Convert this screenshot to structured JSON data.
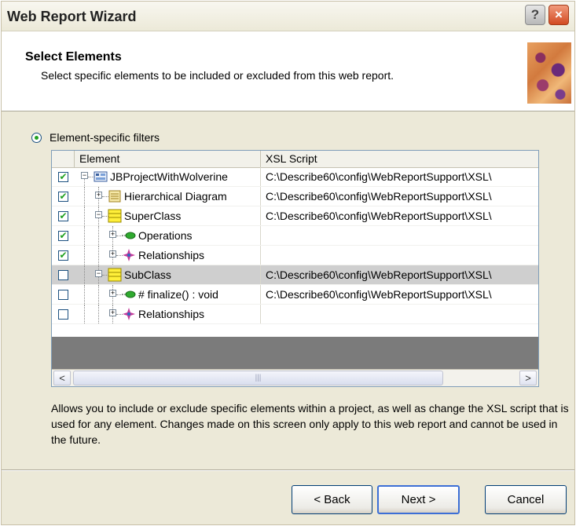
{
  "window": {
    "title": "Web Report Wizard"
  },
  "titlebar": {
    "help_glyph": "?",
    "close_glyph": "×"
  },
  "header": {
    "title": "Select Elements",
    "subtitle": "Select specific elements to be included or excluded from this web report.",
    "art_icon": "wizard-header-art-icon"
  },
  "filter": {
    "radio_label": "Element-specific filters",
    "selected": true
  },
  "grid": {
    "columns": [
      "Element",
      "XSL Script"
    ],
    "rows": [
      {
        "checked": true,
        "expander": "−",
        "icon": "project-icon",
        "label": "JBProjectWithWolverine",
        "xsl": "C:\\Describe60\\config\\WebReportSupport\\XSL\\",
        "selected": false
      },
      {
        "checked": true,
        "expander": "+",
        "icon": "diagram-icon",
        "label": "Hierarchical Diagram",
        "xsl": "C:\\Describe60\\config\\WebReportSupport\\XSL\\",
        "selected": false
      },
      {
        "checked": true,
        "expander": "−",
        "icon": "class-icon",
        "label": "SuperClass",
        "xsl": "C:\\Describe60\\config\\WebReportSupport\\XSL\\",
        "selected": false
      },
      {
        "checked": true,
        "expander": "+",
        "icon": "operations-icon",
        "label": "Operations",
        "xsl": "",
        "selected": false
      },
      {
        "checked": true,
        "expander": "+",
        "icon": "relationships-icon",
        "label": "Relationships",
        "xsl": "",
        "selected": false
      },
      {
        "checked": false,
        "expander": "−",
        "icon": "class-icon",
        "label": "SubClass",
        "xsl": "C:\\Describe60\\config\\WebReportSupport\\XSL\\",
        "selected": true
      },
      {
        "checked": false,
        "expander": "+",
        "icon": "operations-icon",
        "label": "# finalize() : void",
        "xsl": "C:\\Describe60\\config\\WebReportSupport\\XSL\\",
        "selected": false
      },
      {
        "checked": false,
        "expander": "+",
        "icon": "relationships-icon",
        "label": "Relationships",
        "xsl": "",
        "selected": false
      }
    ],
    "scroll_left": "<",
    "scroll_right": ">",
    "scroll_thumb_grip": "|||"
  },
  "description": "Allows you to include or exclude specific elements within a project, as well as change the XSL script that is used for any element.  Changes made on this screen only apply to this web report and cannot be used in the future.",
  "buttons": {
    "back": "< Back",
    "next": "Next >",
    "cancel": "Cancel"
  }
}
